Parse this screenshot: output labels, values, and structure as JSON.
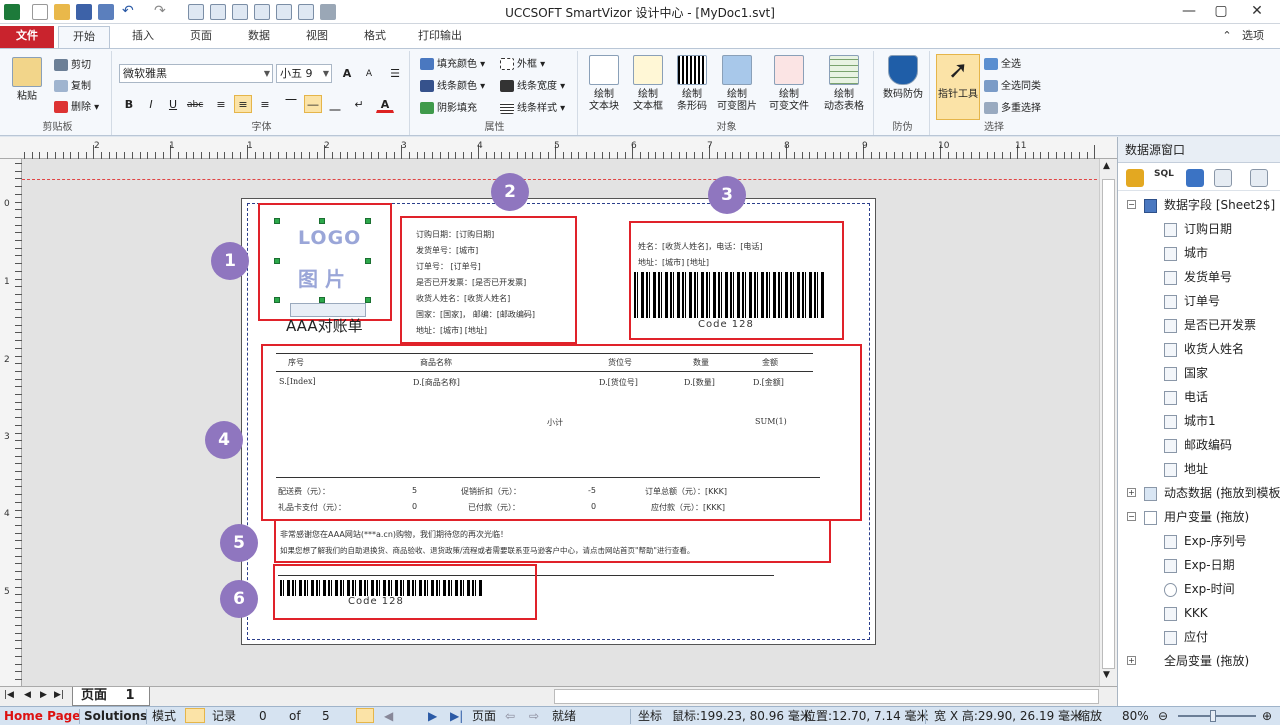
{
  "app": {
    "title": "UCCSOFT SmartVizor 设计中心 - [MyDoc1.svt]"
  },
  "tabs": [
    "文件",
    "开始",
    "插入",
    "页面",
    "数据",
    "视图",
    "格式",
    "打印输出"
  ],
  "options_label": "选项",
  "ribbon": {
    "clipboard": {
      "paste": "粘贴",
      "cut": "剪切",
      "copy": "复制",
      "delete": "删除",
      "label": "剪贴板"
    },
    "font": {
      "name": "微软雅黑",
      "size": "小五 9",
      "label": "字体",
      "bold": "B",
      "italic": "I",
      "underline": "U",
      "strike": "abc",
      "color_glyph": "A"
    },
    "property": {
      "fill_color": "填充颜色",
      "line_color": "线条颜色",
      "shadow_fill": "阴影填充",
      "outer_frame": "外框",
      "line_width": "线条宽度",
      "line_style": "线条样式",
      "label": "属性"
    },
    "object": {
      "items": [
        "绘制\n文本块",
        "绘制\n文本框",
        "绘制\n条形码",
        "绘制\n可变图片",
        "绘制\n可变文件",
        "绘制\n动态表格"
      ],
      "label": "对象"
    },
    "security": {
      "item": "数码防伪",
      "label": "防伪"
    },
    "select": {
      "pointer": "指针工具",
      "select_all": "全选",
      "select_same": "全选同类",
      "multi_select": "多重选择",
      "label": "选择"
    }
  },
  "ruler": {
    "h_labels": [
      "2",
      "1",
      "1",
      "2",
      "3",
      "4",
      "5",
      "6",
      "7",
      "8",
      "9",
      "10",
      "11"
    ],
    "v_labels": [
      "0",
      "1",
      "2",
      "3",
      "4",
      "5"
    ]
  },
  "template": {
    "logo": {
      "line1": "LOGO",
      "line2": "图 片"
    },
    "caption": "AAA对账单",
    "order_info": [
      "订购日期：[订购日期]",
      "发货单号：[城市]",
      "订单号：  [订单号]",
      "是否已开发票：[是否已开发票]",
      "收货人姓名：[收货人姓名]",
      "国家：[国家]，  邮编：[邮政编码]",
      "地址：[城市] [地址]"
    ],
    "recipient": [
      "姓名：[收货人姓名]，电话：[电话]",
      "地址：[城市] [地址]"
    ],
    "barcode_text": "Code 128",
    "table": {
      "headers": [
        "序号",
        "商品名称",
        "货位号",
        "数量",
        "金额"
      ],
      "row": [
        "S.[Index]",
        "D.[商品名称]",
        "D.[货位号]",
        "D.[数量]",
        "D.[金额]"
      ],
      "subtotal_label": "小计",
      "subtotal_value": "SUM(1)"
    },
    "summary": {
      "row1": [
        "配送费（元）：",
        "5",
        "促销折扣（元）：",
        "-5",
        "订单总额（元）：[KKK]"
      ],
      "row2": [
        "礼品卡支付（元）：",
        "0",
        "已付款（元）：",
        "0",
        "应付款（元）：[KKK]"
      ]
    },
    "notes": [
      "非常感谢您在AAA网站(***a.cn)购物，我们期待您的再次光临！",
      "如果您想了解我们的自助退换货、商品验收、退货政策/流程或者需要联系亚马逊客户中心，请点击网站首页\"帮助\"进行查看。"
    ],
    "barcode_text2": "Code 128",
    "markers": [
      "1",
      "2",
      "3",
      "4",
      "5",
      "6"
    ]
  },
  "datasource": {
    "title": "数据源窗口",
    "fields_root": "数据字段 [Sheet2$] (",
    "fields": [
      "订购日期",
      "城市",
      "发货单号",
      "订单号",
      "是否已开发票",
      "收货人姓名",
      "国家",
      "电话",
      "城市1",
      "邮政编码",
      "地址"
    ],
    "dynamic": "动态数据 (拖放到模板",
    "uservar": "用户变量 (拖放)",
    "uservars": [
      "Exp-序列号",
      "Exp-日期",
      "Exp-时间",
      "KKK",
      "应付"
    ],
    "global": "全局变量 (拖放)"
  },
  "pagebar": {
    "label": "页面",
    "num": "1"
  },
  "status": {
    "home": "Home Page",
    "solutions": "Solutions",
    "mode": "模式",
    "record": "记录",
    "rec_cur": "0",
    "of": "of",
    "rec_total": "5",
    "page": "页面",
    "ready": "就绪",
    "coord": "坐标",
    "mouse": "鼠标:199.23, 80.96 毫米",
    "pos": "位置:12.70, 7.14 毫米",
    "size": "宽 X 高:29.90, 26.19 毫米",
    "zoom": "缩放",
    "zoom_val": "80%"
  },
  "colors": {
    "accent": "#c9232d",
    "marker": "#8f76bf",
    "highlight": "#e0222a"
  }
}
